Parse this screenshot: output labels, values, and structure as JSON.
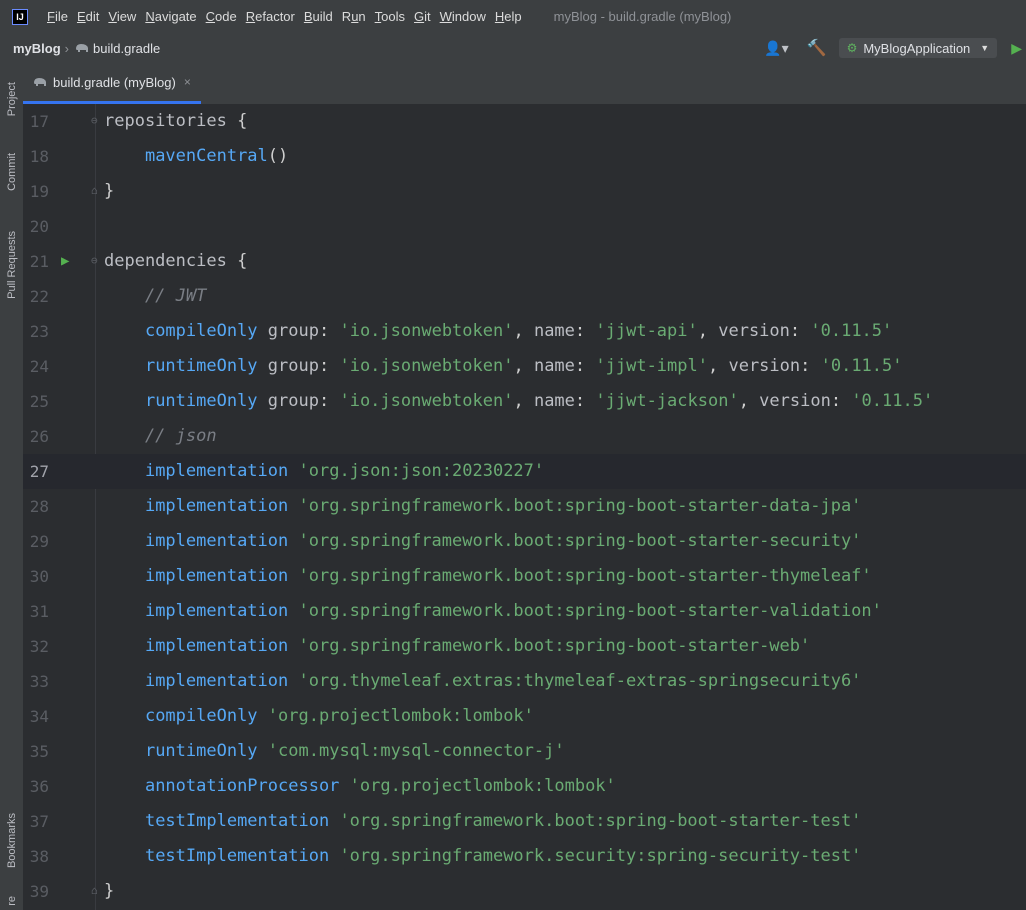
{
  "menubar": {
    "items": [
      {
        "label": "File"
      },
      {
        "label": "Edit"
      },
      {
        "label": "View"
      },
      {
        "label": "Navigate"
      },
      {
        "label": "Code"
      },
      {
        "label": "Refactor"
      },
      {
        "label": "Build"
      },
      {
        "label": "Run"
      },
      {
        "label": "Tools"
      },
      {
        "label": "Git"
      },
      {
        "label": "Window"
      },
      {
        "label": "Help"
      }
    ],
    "window_title": "myBlog - build.gradle (myBlog)",
    "logo_text": "IJ"
  },
  "navbar": {
    "project": "myBlog",
    "file": "build.gradle",
    "run_config": "MyBlogApplication"
  },
  "toolstrip": {
    "project": "Project",
    "commit": "Commit",
    "pull_requests": "Pull Requests",
    "bookmarks": "Bookmarks",
    "structure": "re"
  },
  "tab": {
    "label": "build.gradle (myBlog)",
    "close": "×"
  },
  "editor": {
    "current_line": 27,
    "lines": [
      {
        "n": "17",
        "code": "repositories {"
      },
      {
        "n": "18",
        "code": "    mavenCentral()"
      },
      {
        "n": "19",
        "code": "}"
      },
      {
        "n": "20",
        "code": ""
      },
      {
        "n": "21",
        "code": "dependencies {"
      },
      {
        "n": "22",
        "code": "    // JWT"
      },
      {
        "n": "23",
        "code": "    compileOnly group: 'io.jsonwebtoken', name: 'jjwt-api', version: '0.11.5'"
      },
      {
        "n": "24",
        "code": "    runtimeOnly group: 'io.jsonwebtoken', name: 'jjwt-impl', version: '0.11.5'"
      },
      {
        "n": "25",
        "code": "    runtimeOnly group: 'io.jsonwebtoken', name: 'jjwt-jackson', version: '0.11.5'"
      },
      {
        "n": "26",
        "code": "    // json"
      },
      {
        "n": "27",
        "code": "    implementation 'org.json:json:20230227'"
      },
      {
        "n": "28",
        "code": "    implementation 'org.springframework.boot:spring-boot-starter-data-jpa'"
      },
      {
        "n": "29",
        "code": "    implementation 'org.springframework.boot:spring-boot-starter-security'"
      },
      {
        "n": "30",
        "code": "    implementation 'org.springframework.boot:spring-boot-starter-thymeleaf'"
      },
      {
        "n": "31",
        "code": "    implementation 'org.springframework.boot:spring-boot-starter-validation'"
      },
      {
        "n": "32",
        "code": "    implementation 'org.springframework.boot:spring-boot-starter-web'"
      },
      {
        "n": "33",
        "code": "    implementation 'org.thymeleaf.extras:thymeleaf-extras-springsecurity6'"
      },
      {
        "n": "34",
        "code": "    compileOnly 'org.projectlombok:lombok'"
      },
      {
        "n": "35",
        "code": "    runtimeOnly 'com.mysql:mysql-connector-j'"
      },
      {
        "n": "36",
        "code": "    annotationProcessor 'org.projectlombok:lombok'"
      },
      {
        "n": "37",
        "code": "    testImplementation 'org.springframework.boot:spring-boot-starter-test'"
      },
      {
        "n": "38",
        "code": "    testImplementation 'org.springframework.security:spring-security-test'"
      },
      {
        "n": "39",
        "code": "}"
      }
    ]
  },
  "colors": {
    "method": "#56a8f5",
    "string": "#6aab73",
    "comment": "#7a7e85",
    "accent": "#3574f0",
    "run_green": "#55b150"
  }
}
